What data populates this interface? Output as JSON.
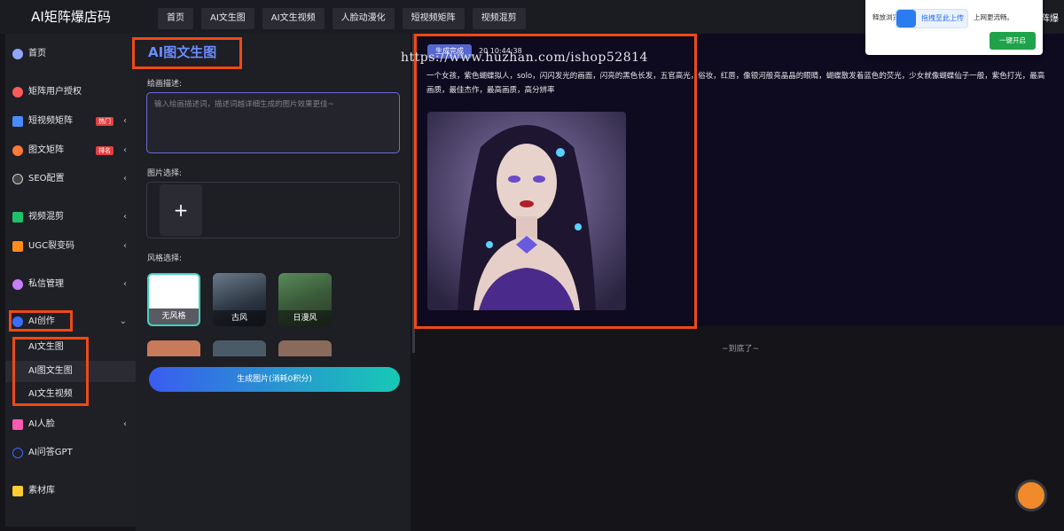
{
  "app": {
    "title": "AI矩阵爆店码",
    "top_right": "矩阵爆"
  },
  "topnav": [
    "首页",
    "AI文生图",
    "AI文生视频",
    "人脸动漫化",
    "短视频矩阵",
    "视频混剪"
  ],
  "sidebar": {
    "items": [
      {
        "label": "首页",
        "icon": "pie-icon",
        "color": "#8ea6ff"
      },
      {
        "label": "矩阵用户授权",
        "icon": "user-icon",
        "color": "#ff5a5a"
      },
      {
        "label": "短视频矩阵",
        "icon": "video-icon",
        "color": "#4a8cff",
        "badge": "热门"
      },
      {
        "label": "图文矩阵",
        "icon": "image-icon",
        "color": "#ff7a3a",
        "badge": "排名"
      },
      {
        "label": "SEO配置",
        "icon": "seo-icon",
        "color": "#cccccc"
      },
      {
        "label": "视频混剪",
        "icon": "film-icon",
        "color": "#1fc06a"
      },
      {
        "label": "UGC裂变码",
        "icon": "ugc-icon",
        "color": "#ff8c1a"
      },
      {
        "label": "私信管理",
        "icon": "message-icon",
        "color": "#c87cff"
      },
      {
        "label": "AI创作",
        "icon": "ai-icon",
        "color": "#3a6cff"
      },
      {
        "label": "AI人脸",
        "icon": "face-icon",
        "color": "#ff5ab0"
      },
      {
        "label": "AI问答GPT",
        "icon": "gpt-icon",
        "color": "#3a6cff"
      },
      {
        "label": "素材库",
        "icon": "folder-icon",
        "color": "#ffcc33"
      }
    ],
    "subitems": [
      "AI文生图",
      "AI图文生图",
      "AI文生视频"
    ]
  },
  "form": {
    "title": "AI图文生图",
    "desc_label": "绘画描述:",
    "desc_placeholder": "输入绘画描述词，描述词越详细生成的图片效果更佳~",
    "image_label": "图片选择:",
    "plus": "+",
    "style_label": "风格选择:",
    "styles": [
      "无风格",
      "古风",
      "日漫风"
    ],
    "generate": "生成图片(消耗0积分)"
  },
  "result": {
    "status": "生成完成",
    "time": "20      10:44:38",
    "prompt": "一个女孩，紫色蝴蝶拟人，solo，闪闪发光的画面，闪亮的黑色长发，五官高光，俗妆，红唇，像银河般亮晶晶的眼睛，蝴蝶散发着蓝色的荧光，少女就像蝴蝶仙子一般，紫色打光，最高画质，最佳杰作，最高画质，高分辨率",
    "end": "~到底了~"
  },
  "watermark": "https://www.huzhan.com/ishop52814",
  "popup": {
    "text_left": "释放浏览",
    "pill": "拖拽至此上传",
    "text_right": "上网更流畅。",
    "ok": "一键开启"
  }
}
